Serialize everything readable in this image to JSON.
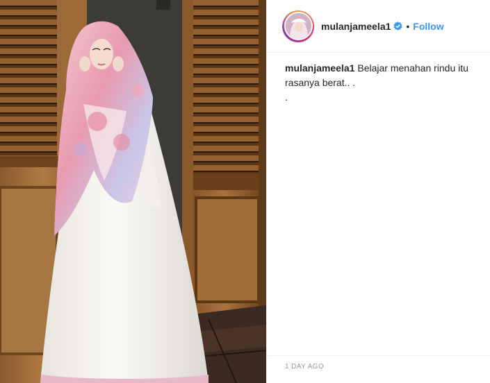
{
  "post": {
    "username": "mulanjameela1",
    "separator": "•",
    "follow_label": "Follow",
    "caption_username": "mulanjameela1",
    "caption_text": "Belajar menahan rindu itu rasanya berat.. .",
    "caption_extra": ".",
    "timestamp": "1 DAY AGO"
  },
  "icons": {
    "verified": "verified-badge-icon"
  },
  "colors": {
    "follow": "#3897f0",
    "timestamp": "#999999",
    "text": "#262626"
  }
}
